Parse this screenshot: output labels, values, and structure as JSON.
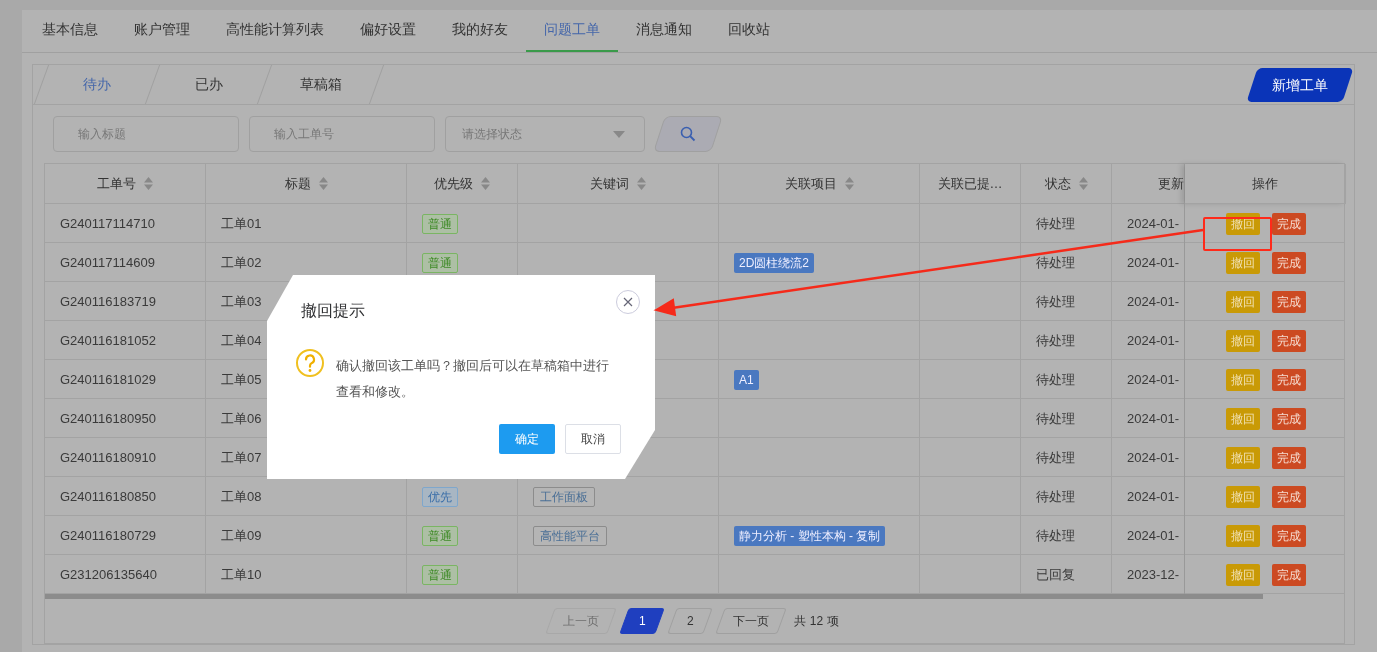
{
  "tabs": [
    {
      "label": "基本信息",
      "selected": false
    },
    {
      "label": "账户管理",
      "selected": false
    },
    {
      "label": "高性能计算列表",
      "selected": false
    },
    {
      "label": "偏好设置",
      "selected": false
    },
    {
      "label": "我的好友",
      "selected": false
    },
    {
      "label": "问题工单",
      "selected": true
    },
    {
      "label": "消息通知",
      "selected": false
    },
    {
      "label": "回收站",
      "selected": false
    }
  ],
  "subtabs": [
    {
      "label": "待办",
      "selected": true
    },
    {
      "label": "已办",
      "selected": false
    },
    {
      "label": "草稿箱",
      "selected": false
    }
  ],
  "new_button": "新增工单",
  "filters": {
    "title_placeholder": "输入标题",
    "number_placeholder": "输入工单号",
    "status_placeholder": "请选择状态"
  },
  "table": {
    "columns": [
      {
        "label": "工单号",
        "sortable": true
      },
      {
        "label": "标题",
        "sortable": true
      },
      {
        "label": "优先级",
        "sortable": true
      },
      {
        "label": "关键词",
        "sortable": true
      },
      {
        "label": "关联项目",
        "sortable": true
      },
      {
        "label": "关联已提…",
        "sortable": false
      },
      {
        "label": "状态",
        "sortable": true
      },
      {
        "label": "更新",
        "sortable": false
      },
      {
        "label": "操作",
        "sortable": false
      }
    ],
    "rows": [
      {
        "number": "G240117114710",
        "title": "工单01",
        "priority": {
          "text": "普通",
          "kind": "normal"
        },
        "status": "待处理",
        "updated": "2024-01-",
        "actions": [
          "撤回",
          "完成"
        ]
      },
      {
        "number": "G240117114609",
        "title": "工单02",
        "priority": {
          "text": "普通",
          "kind": "normal"
        },
        "project": "2D圆柱绕流2",
        "status": "待处理",
        "updated": "2024-01-",
        "actions": [
          "撤回",
          "完成"
        ]
      },
      {
        "number": "G240116183719",
        "title": "工单03",
        "status": "待处理",
        "updated": "2024-01-",
        "actions": [
          "撤回",
          "完成"
        ]
      },
      {
        "number": "G240116181052",
        "title": "工单04",
        "status": "待处理",
        "updated": "2024-01-",
        "actions": [
          "撤回",
          "完成"
        ]
      },
      {
        "number": "G240116181029",
        "title": "工单05",
        "project": "A1",
        "status": "待处理",
        "updated": "2024-01-",
        "actions": [
          "撤回",
          "完成"
        ]
      },
      {
        "number": "G240116180950",
        "title": "工单06",
        "status": "待处理",
        "updated": "2024-01-",
        "actions": [
          "撤回",
          "完成"
        ]
      },
      {
        "number": "G240116180910",
        "title": "工单07",
        "status": "待处理",
        "updated": "2024-01-",
        "actions": [
          "撤回",
          "完成"
        ]
      },
      {
        "number": "G240116180850",
        "title": "工单08",
        "priority": {
          "text": "优先",
          "kind": "high"
        },
        "keyword": "工作面板",
        "status": "待处理",
        "updated": "2024-01-",
        "actions": [
          "撤回",
          "完成"
        ]
      },
      {
        "number": "G240116180729",
        "title": "工单09",
        "priority": {
          "text": "普通",
          "kind": "normal"
        },
        "keyword": "高性能平台",
        "project": "静力分析 - 塑性本构 - 复制",
        "status": "待处理",
        "updated": "2024-01-",
        "actions": [
          "撤回",
          "完成"
        ]
      },
      {
        "number": "G231206135640",
        "title": "工单10",
        "priority": {
          "text": "普通",
          "kind": "normal"
        },
        "status": "已回复",
        "updated": "2023-12-",
        "actions": [
          "撤回",
          "完成"
        ]
      }
    ]
  },
  "pagination": {
    "prev": {
      "label": "上一页",
      "disabled": true
    },
    "pages": [
      {
        "label": "1",
        "selected": true
      },
      {
        "label": "2",
        "selected": false
      }
    ],
    "next": {
      "label": "下一页",
      "disabled": false
    },
    "total": "共 12 项"
  },
  "dialog": {
    "title": "撤回提示",
    "message": "确认撤回该工单吗？撤回后可以在草稿箱中进行查看和修改。",
    "confirm": "确定",
    "cancel": "取消"
  }
}
